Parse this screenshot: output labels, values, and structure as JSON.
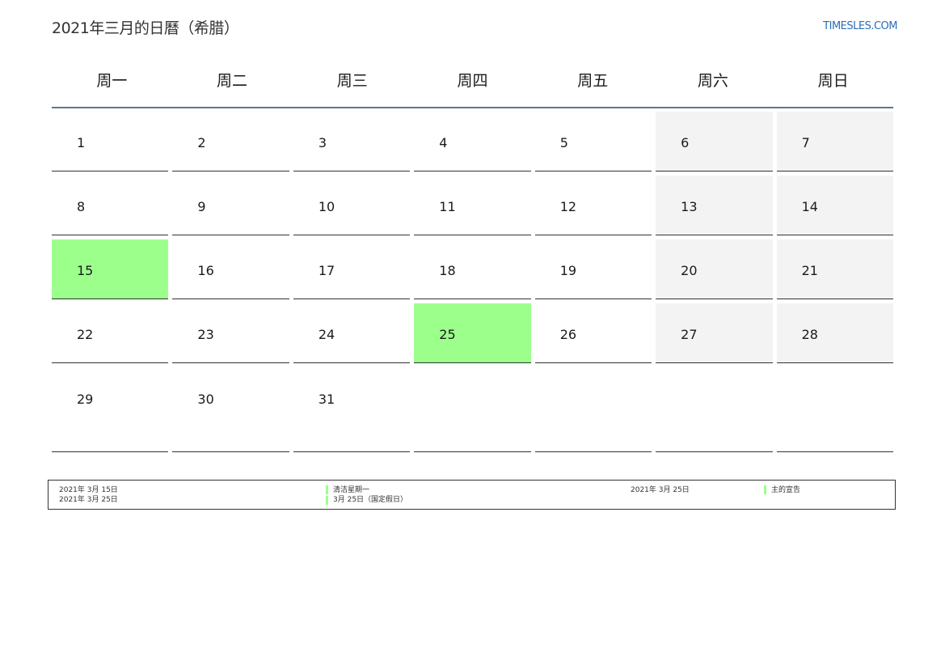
{
  "header": {
    "title": "2021年三月的日曆（希腊）",
    "site": "TIMESLES.COM"
  },
  "weekdays": [
    "周一",
    "周二",
    "周三",
    "周四",
    "周五",
    "周六",
    "周日"
  ],
  "days": [
    [
      "1",
      "2",
      "3",
      "4",
      "5",
      "6",
      "7"
    ],
    [
      "8",
      "9",
      "10",
      "11",
      "12",
      "13",
      "14"
    ],
    [
      "15",
      "16",
      "17",
      "18",
      "19",
      "20",
      "21"
    ],
    [
      "22",
      "23",
      "24",
      "25",
      "26",
      "27",
      "28"
    ],
    [
      "29",
      "30",
      "31",
      "",
      "",
      "",
      ""
    ]
  ],
  "highlighted_days": [
    "15",
    "25"
  ],
  "colors": {
    "holiday": "#9cff8c",
    "weekend": "#f3f3f3",
    "accent_line": "#5b7796",
    "site_link": "#2a6ebb"
  },
  "legend": [
    {
      "date": "2021年 3月 15日",
      "name": "清洁星期一"
    },
    {
      "date": "2021年 3月 25日",
      "name": "3月 25日（国定假日）"
    },
    {
      "date": "2021年 3月 25日",
      "name": "主的宣告"
    }
  ]
}
